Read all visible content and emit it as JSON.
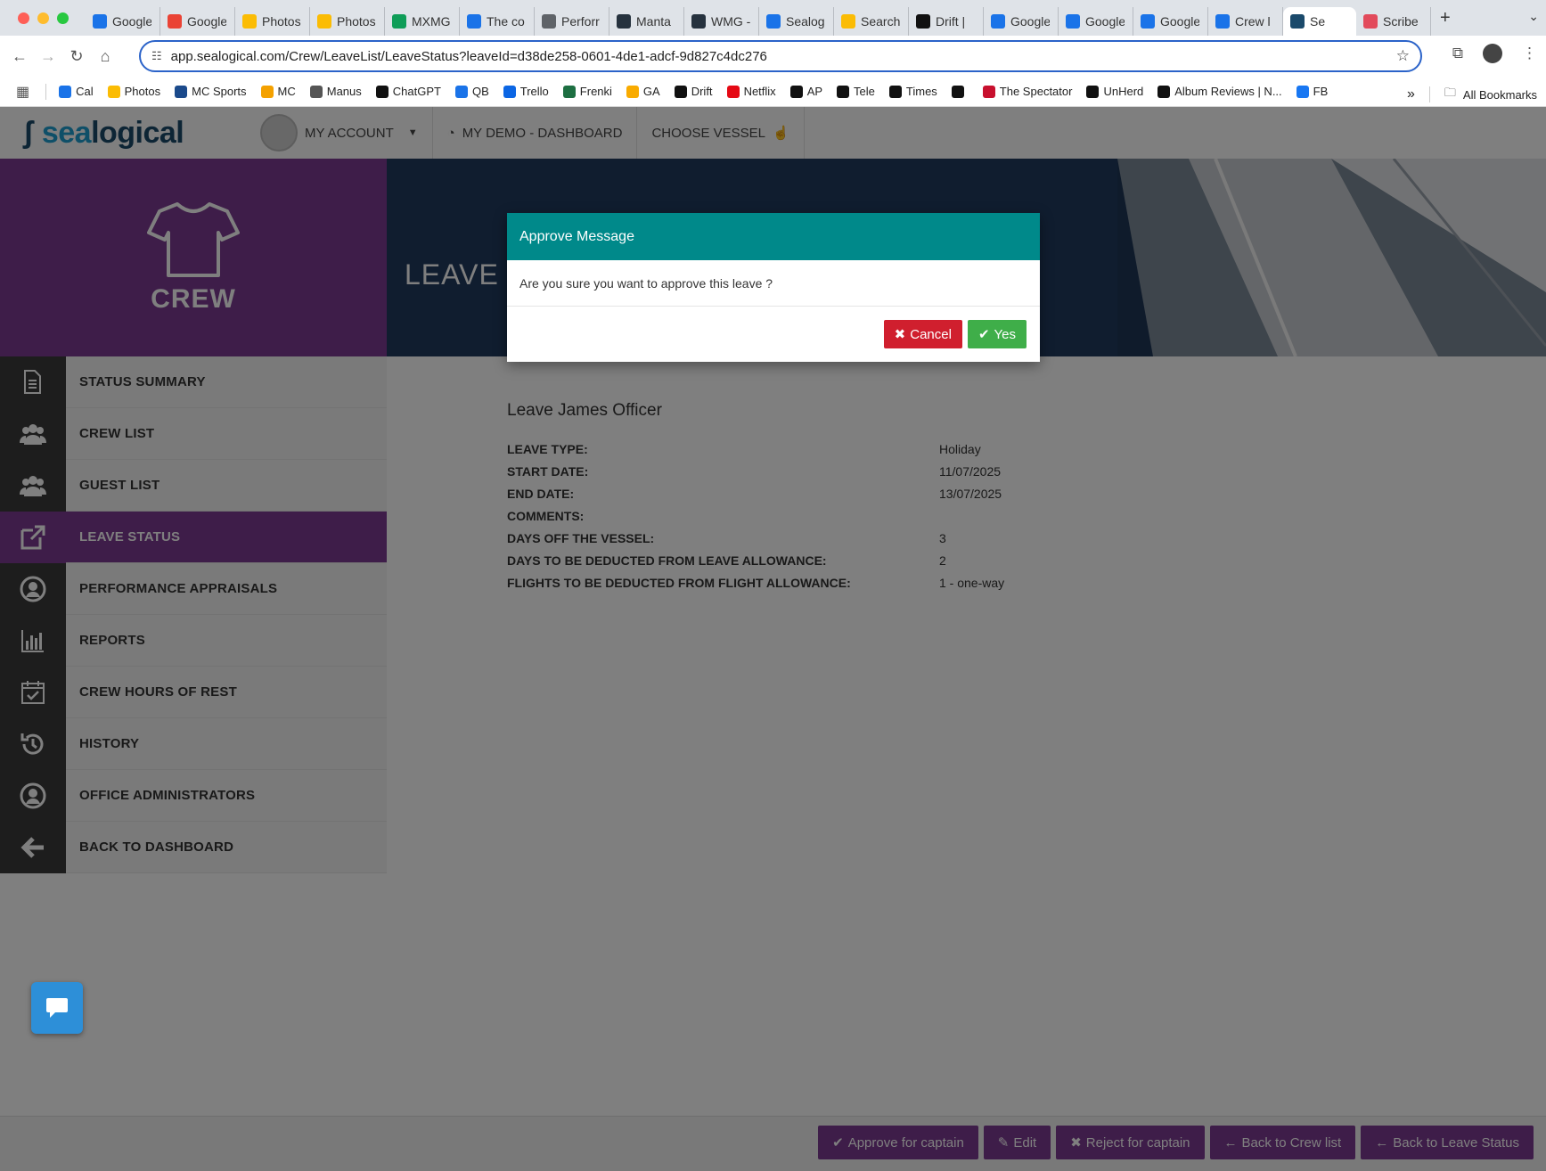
{
  "browser": {
    "tabs": [
      {
        "label": "Google",
        "icon": "calendar-icon",
        "color": "#1a73e8"
      },
      {
        "label": "Google",
        "icon": "google-icon",
        "color": "#ea4335"
      },
      {
        "label": "Photos",
        "icon": "photos-icon",
        "color": "#fbbc04"
      },
      {
        "label": "Photos",
        "icon": "photos-icon",
        "color": "#fbbc04"
      },
      {
        "label": "MXMG",
        "icon": "mxmg-icon",
        "color": "#0f9d58"
      },
      {
        "label": "The co",
        "icon": "clock-icon",
        "color": "#1a73e8"
      },
      {
        "label": "Perforr",
        "icon": "globe-icon",
        "color": "#5f6368"
      },
      {
        "label": "Manta",
        "icon": "trello-icon",
        "color": "#26323e"
      },
      {
        "label": "WMG -",
        "icon": "trello-icon",
        "color": "#26323e"
      },
      {
        "label": "Sealog",
        "icon": "sealog-icon",
        "color": "#1a73e8"
      },
      {
        "label": "Search",
        "icon": "ads-icon",
        "color": "#fbbc04"
      },
      {
        "label": "Drift | ",
        "icon": "drift-icon",
        "color": "#111111"
      },
      {
        "label": "Google",
        "icon": "globe-icon",
        "color": "#1a73e8"
      },
      {
        "label": "Google",
        "icon": "globe-icon",
        "color": "#1a73e8"
      },
      {
        "label": "Google",
        "icon": "globe-icon",
        "color": "#1a73e8"
      },
      {
        "label": "Crew l",
        "icon": "globe-icon",
        "color": "#1a73e8"
      },
      {
        "label": "Se",
        "icon": "sealogical-icon",
        "color": "#1b4a6b",
        "active": true
      },
      {
        "label": "Scribe",
        "icon": "scribe-icon",
        "color": "#e24a5b"
      }
    ],
    "url": "app.sealogical.com/Crew/LeaveList/LeaveStatus?leaveId=d38de258-0601-4de1-adcf-9d827c4dc276",
    "bookmarks": [
      {
        "label": "Cal",
        "icon": "calendar-icon",
        "color": "#1a73e8"
      },
      {
        "label": "Photos",
        "icon": "photos-icon",
        "color": "#fbbc04"
      },
      {
        "label": "MC Sports",
        "icon": "mc-sports-icon",
        "color": "#1b4a8b"
      },
      {
        "label": "MC",
        "icon": "mc-icon",
        "color": "#f4a100"
      },
      {
        "label": "Manus",
        "icon": "manus-icon",
        "color": "#555555"
      },
      {
        "label": "ChatGPT",
        "icon": "chatgpt-icon",
        "color": "#111111"
      },
      {
        "label": "QB",
        "icon": "qb-icon",
        "color": "#1a73e8"
      },
      {
        "label": "Trello",
        "icon": "trello-icon",
        "color": "#0c66e4"
      },
      {
        "label": "Frenki",
        "icon": "excel-icon",
        "color": "#1d6f42"
      },
      {
        "label": "GA",
        "icon": "analytics-icon",
        "color": "#f9ab00"
      },
      {
        "label": "Drift",
        "icon": "drift-icon",
        "color": "#111111"
      },
      {
        "label": "Netflix",
        "icon": "netflix-icon",
        "color": "#e50914"
      },
      {
        "label": "AP",
        "icon": "amazon-icon",
        "color": "#111111"
      },
      {
        "label": "Tele",
        "icon": "tele-icon",
        "color": "#111111"
      },
      {
        "label": "Times",
        "icon": "times-icon",
        "color": "#111111"
      },
      {
        "label": "",
        "icon": "circle-logo-icon",
        "color": "#111111"
      },
      {
        "label": "The Spectator",
        "icon": "spectator-icon",
        "color": "#c8102e"
      },
      {
        "label": "UnHerd",
        "icon": "unherd-icon",
        "color": "#111111"
      },
      {
        "label": "Album Reviews | N...",
        "icon": "nme-icon",
        "color": "#111111"
      },
      {
        "label": "FB",
        "icon": "facebook-icon",
        "color": "#1877f2"
      }
    ],
    "all_bookmarks": "All Bookmarks"
  },
  "app": {
    "logo": {
      "part1": "sea",
      "part2": "logical"
    },
    "nav": {
      "account": "MY ACCOUNT",
      "dashboard": "MY DEMO - DASHBOARD",
      "vessel": "CHOOSE VESSEL"
    },
    "section_title": "CREW",
    "banner_title": "LEAVE ST",
    "sidebar": [
      {
        "label": "STATUS SUMMARY",
        "icon": "document-icon"
      },
      {
        "label": "CREW LIST",
        "icon": "users-icon"
      },
      {
        "label": "GUEST LIST",
        "icon": "users-icon"
      },
      {
        "label": "LEAVE STATUS",
        "icon": "external-link-icon",
        "active": true
      },
      {
        "label": "PERFORMANCE APPRAISALS",
        "icon": "user-circle-icon"
      },
      {
        "label": "REPORTS",
        "icon": "bar-chart-icon"
      },
      {
        "label": "CREW HOURS OF REST",
        "icon": "calendar-check-icon"
      },
      {
        "label": "HISTORY",
        "icon": "history-icon"
      },
      {
        "label": "OFFICE ADMINISTRATORS",
        "icon": "user-circle-icon"
      },
      {
        "label": "BACK TO DASHBOARD",
        "icon": "arrow-left-icon"
      }
    ],
    "leave": {
      "heading": "Leave James Officer",
      "rows": [
        {
          "label": "LEAVE TYPE:",
          "value": "Holiday"
        },
        {
          "label": "START DATE:",
          "value": "11/07/2025"
        },
        {
          "label": "END DATE:",
          "value": "13/07/2025"
        },
        {
          "label": "COMMENTS:",
          "value": ""
        },
        {
          "label": "DAYS OFF THE VESSEL:",
          "value": "3"
        },
        {
          "label": "DAYS TO BE DEDUCTED FROM LEAVE ALLOWANCE:",
          "value": "2"
        },
        {
          "label": "FLIGHTS TO BE DEDUCTED FROM FLIGHT ALLOWANCE:",
          "value": "1 - one-way"
        }
      ]
    },
    "actions": [
      {
        "label": "Approve for captain",
        "icon": "✔"
      },
      {
        "label": "Edit",
        "icon": "✎"
      },
      {
        "label": "Reject for captain",
        "icon": "✖"
      },
      {
        "label": "Back to Crew list",
        "icon": "←"
      },
      {
        "label": "Back to Leave Status",
        "icon": "←"
      }
    ]
  },
  "modal": {
    "title": "Approve Message",
    "body": "Are you sure you want to approve this leave ?",
    "cancel": "Cancel",
    "yes": "Yes"
  },
  "colors": {
    "brand_purple": "#7d3a92",
    "modal_header": "#00898a",
    "cancel_red": "#d01f2e",
    "yes_green": "#3fae49"
  }
}
